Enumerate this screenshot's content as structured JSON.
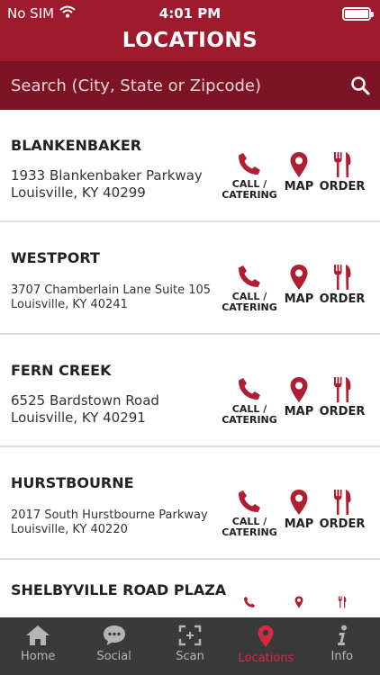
{
  "status": {
    "carrier": "No SIM",
    "time": "4:01 PM"
  },
  "title": "LOCATIONS",
  "search": {
    "placeholder": "Search (City, State or Zipcode)"
  },
  "actions": {
    "call": "CALL /",
    "call2": "CATERING",
    "map": "MAP",
    "order": "ORDER"
  },
  "locations": [
    {
      "name": "BLANKENBAKER",
      "line1": "1933 Blankenbaker Parkway",
      "line2": "Louisville, KY 40299"
    },
    {
      "name": "WESTPORT",
      "line1": "3707 Chamberlain Lane Suite 105",
      "line2": "Louisville, KY 40241"
    },
    {
      "name": "FERN CREEK",
      "line1": "6525 Bardstown Road",
      "line2": "Louisville, KY 40291"
    },
    {
      "name": "HURSTBOURNE",
      "line1": "2017 South Hurstbourne Parkway",
      "line2": "Louisville, KY 40220"
    },
    {
      "name": "SHELBYVILLE ROAD PLAZA"
    }
  ],
  "tabs": [
    {
      "label": "Home",
      "icon": "home-icon"
    },
    {
      "label": "Social",
      "icon": "chat-bubble-icon"
    },
    {
      "label": "Scan",
      "icon": "scan-icon"
    },
    {
      "label": "Locations",
      "icon": "location-pin-icon",
      "active": true
    },
    {
      "label": "Info",
      "icon": "info-icon"
    }
  ],
  "colors": {
    "brand": "#9e1b2d",
    "brand_dark": "#7d1423",
    "accent": "#b01e33",
    "tabbar": "#3a3a3a"
  }
}
